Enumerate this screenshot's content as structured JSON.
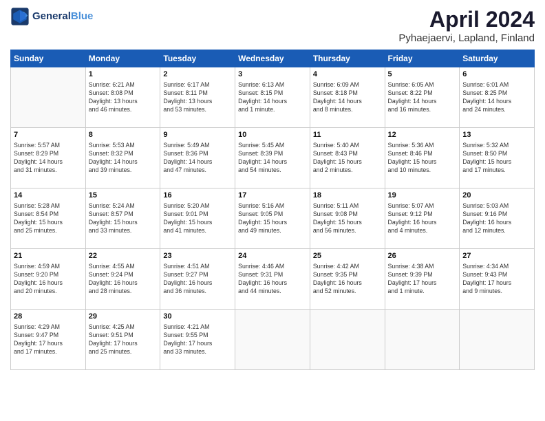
{
  "header": {
    "logo_line1": "General",
    "logo_line2": "Blue",
    "title": "April 2024",
    "subtitle": "Pyhaejaervi, Lapland, Finland"
  },
  "calendar": {
    "weekdays": [
      "Sunday",
      "Monday",
      "Tuesday",
      "Wednesday",
      "Thursday",
      "Friday",
      "Saturday"
    ],
    "weeks": [
      [
        {
          "day": "",
          "info": ""
        },
        {
          "day": "1",
          "info": "Sunrise: 6:21 AM\nSunset: 8:08 PM\nDaylight: 13 hours\nand 46 minutes."
        },
        {
          "day": "2",
          "info": "Sunrise: 6:17 AM\nSunset: 8:11 PM\nDaylight: 13 hours\nand 53 minutes."
        },
        {
          "day": "3",
          "info": "Sunrise: 6:13 AM\nSunset: 8:15 PM\nDaylight: 14 hours\nand 1 minute."
        },
        {
          "day": "4",
          "info": "Sunrise: 6:09 AM\nSunset: 8:18 PM\nDaylight: 14 hours\nand 8 minutes."
        },
        {
          "day": "5",
          "info": "Sunrise: 6:05 AM\nSunset: 8:22 PM\nDaylight: 14 hours\nand 16 minutes."
        },
        {
          "day": "6",
          "info": "Sunrise: 6:01 AM\nSunset: 8:25 PM\nDaylight: 14 hours\nand 24 minutes."
        }
      ],
      [
        {
          "day": "7",
          "info": "Sunrise: 5:57 AM\nSunset: 8:29 PM\nDaylight: 14 hours\nand 31 minutes."
        },
        {
          "day": "8",
          "info": "Sunrise: 5:53 AM\nSunset: 8:32 PM\nDaylight: 14 hours\nand 39 minutes."
        },
        {
          "day": "9",
          "info": "Sunrise: 5:49 AM\nSunset: 8:36 PM\nDaylight: 14 hours\nand 47 minutes."
        },
        {
          "day": "10",
          "info": "Sunrise: 5:45 AM\nSunset: 8:39 PM\nDaylight: 14 hours\nand 54 minutes."
        },
        {
          "day": "11",
          "info": "Sunrise: 5:40 AM\nSunset: 8:43 PM\nDaylight: 15 hours\nand 2 minutes."
        },
        {
          "day": "12",
          "info": "Sunrise: 5:36 AM\nSunset: 8:46 PM\nDaylight: 15 hours\nand 10 minutes."
        },
        {
          "day": "13",
          "info": "Sunrise: 5:32 AM\nSunset: 8:50 PM\nDaylight: 15 hours\nand 17 minutes."
        }
      ],
      [
        {
          "day": "14",
          "info": "Sunrise: 5:28 AM\nSunset: 8:54 PM\nDaylight: 15 hours\nand 25 minutes."
        },
        {
          "day": "15",
          "info": "Sunrise: 5:24 AM\nSunset: 8:57 PM\nDaylight: 15 hours\nand 33 minutes."
        },
        {
          "day": "16",
          "info": "Sunrise: 5:20 AM\nSunset: 9:01 PM\nDaylight: 15 hours\nand 41 minutes."
        },
        {
          "day": "17",
          "info": "Sunrise: 5:16 AM\nSunset: 9:05 PM\nDaylight: 15 hours\nand 49 minutes."
        },
        {
          "day": "18",
          "info": "Sunrise: 5:11 AM\nSunset: 9:08 PM\nDaylight: 15 hours\nand 56 minutes."
        },
        {
          "day": "19",
          "info": "Sunrise: 5:07 AM\nSunset: 9:12 PM\nDaylight: 16 hours\nand 4 minutes."
        },
        {
          "day": "20",
          "info": "Sunrise: 5:03 AM\nSunset: 9:16 PM\nDaylight: 16 hours\nand 12 minutes."
        }
      ],
      [
        {
          "day": "21",
          "info": "Sunrise: 4:59 AM\nSunset: 9:20 PM\nDaylight: 16 hours\nand 20 minutes."
        },
        {
          "day": "22",
          "info": "Sunrise: 4:55 AM\nSunset: 9:24 PM\nDaylight: 16 hours\nand 28 minutes."
        },
        {
          "day": "23",
          "info": "Sunrise: 4:51 AM\nSunset: 9:27 PM\nDaylight: 16 hours\nand 36 minutes."
        },
        {
          "day": "24",
          "info": "Sunrise: 4:46 AM\nSunset: 9:31 PM\nDaylight: 16 hours\nand 44 minutes."
        },
        {
          "day": "25",
          "info": "Sunrise: 4:42 AM\nSunset: 9:35 PM\nDaylight: 16 hours\nand 52 minutes."
        },
        {
          "day": "26",
          "info": "Sunrise: 4:38 AM\nSunset: 9:39 PM\nDaylight: 17 hours\nand 1 minute."
        },
        {
          "day": "27",
          "info": "Sunrise: 4:34 AM\nSunset: 9:43 PM\nDaylight: 17 hours\nand 9 minutes."
        }
      ],
      [
        {
          "day": "28",
          "info": "Sunrise: 4:29 AM\nSunset: 9:47 PM\nDaylight: 17 hours\nand 17 minutes."
        },
        {
          "day": "29",
          "info": "Sunrise: 4:25 AM\nSunset: 9:51 PM\nDaylight: 17 hours\nand 25 minutes."
        },
        {
          "day": "30",
          "info": "Sunrise: 4:21 AM\nSunset: 9:55 PM\nDaylight: 17 hours\nand 33 minutes."
        },
        {
          "day": "",
          "info": ""
        },
        {
          "day": "",
          "info": ""
        },
        {
          "day": "",
          "info": ""
        },
        {
          "day": "",
          "info": ""
        }
      ]
    ]
  }
}
